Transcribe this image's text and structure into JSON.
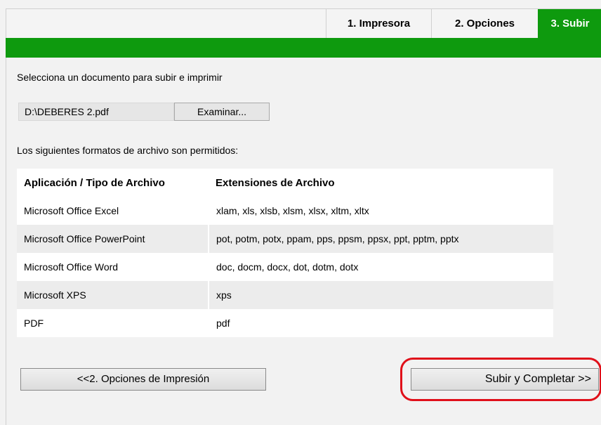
{
  "tabs": [
    {
      "label": "1. Impresora",
      "active": false
    },
    {
      "label": "2. Opciones",
      "active": false
    },
    {
      "label": "3. Subir",
      "active": true
    }
  ],
  "colors": {
    "accent_green": "#0e9a0e",
    "highlight_red": "#e0101a"
  },
  "upload": {
    "instruction": "Selecciona un documento para subir e imprimir",
    "file_value": "D:\\DEBERES 2.pdf",
    "browse_label": "Examinar..."
  },
  "formats": {
    "label": "Los siguientes formatos de archivo son permitidos:",
    "headers": [
      "Aplicación / Tipo de Archivo",
      "Extensiones de Archivo"
    ],
    "rows": [
      [
        "Microsoft Office Excel",
        "xlam, xls, xlsb, xlsm, xlsx, xltm, xltx"
      ],
      [
        "Microsoft Office PowerPoint",
        "pot, potm, potx, ppam, pps, ppsm, ppsx, ppt, pptm, pptx"
      ],
      [
        "Microsoft Office Word",
        "doc, docm, docx, dot, dotm, dotx"
      ],
      [
        "Microsoft XPS",
        "xps"
      ],
      [
        "PDF",
        "pdf"
      ]
    ]
  },
  "actions": {
    "back_label": "<<2. Opciones de Impresión",
    "upload_label": "Subir y Completar >>"
  }
}
